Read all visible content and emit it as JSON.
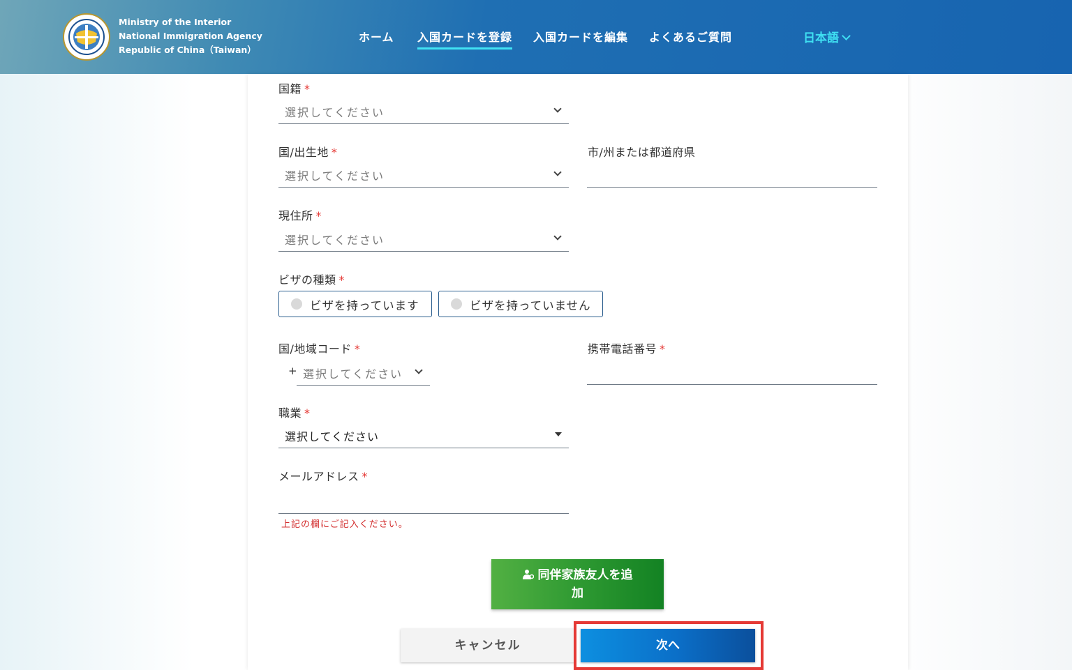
{
  "header": {
    "agency_lines": [
      "Ministry of the Interior",
      "National Immigration Agency",
      "Republic of China（Taiwan）"
    ],
    "nav": [
      {
        "label": "ホーム"
      },
      {
        "label": "入国カードを登録"
      },
      {
        "label": "入国カードを編集"
      },
      {
        "label": "よくあるご質問"
      }
    ],
    "language": "日本語"
  },
  "form": {
    "nationality": {
      "label": "国籍",
      "placeholder": "選択してください"
    },
    "birthplace": {
      "label": "国/出生地",
      "placeholder": "選択してください"
    },
    "city_state": {
      "label": "市/州または都道府県",
      "value": ""
    },
    "residence": {
      "label": "現住所",
      "placeholder": "選択してください"
    },
    "visa_type": {
      "label": "ビザの種類",
      "options": [
        "ビザを持っています",
        "ビザを持っていません"
      ]
    },
    "country_code": {
      "label": "国/地域コード",
      "prefix": "+",
      "placeholder": "選択してください"
    },
    "mobile": {
      "label": "携帯電話番号",
      "value": ""
    },
    "occupation": {
      "label": "職業",
      "value": "選択してください"
    },
    "email": {
      "label": "メールアドレス",
      "value": "",
      "error": "上記の欄にご記入ください。"
    },
    "required_mark": "*"
  },
  "buttons": {
    "add_companion_line1": "同伴家族友人を追",
    "add_companion_line2": "加",
    "cancel": "キャンセル",
    "next": "次へ"
  },
  "colors": {
    "header": "#1764b0",
    "accent": "#41e3f4",
    "add_button": "#2f9a32",
    "next_button": "#0b6fc8",
    "highlight_border": "#e53935",
    "required": "#e53935"
  }
}
